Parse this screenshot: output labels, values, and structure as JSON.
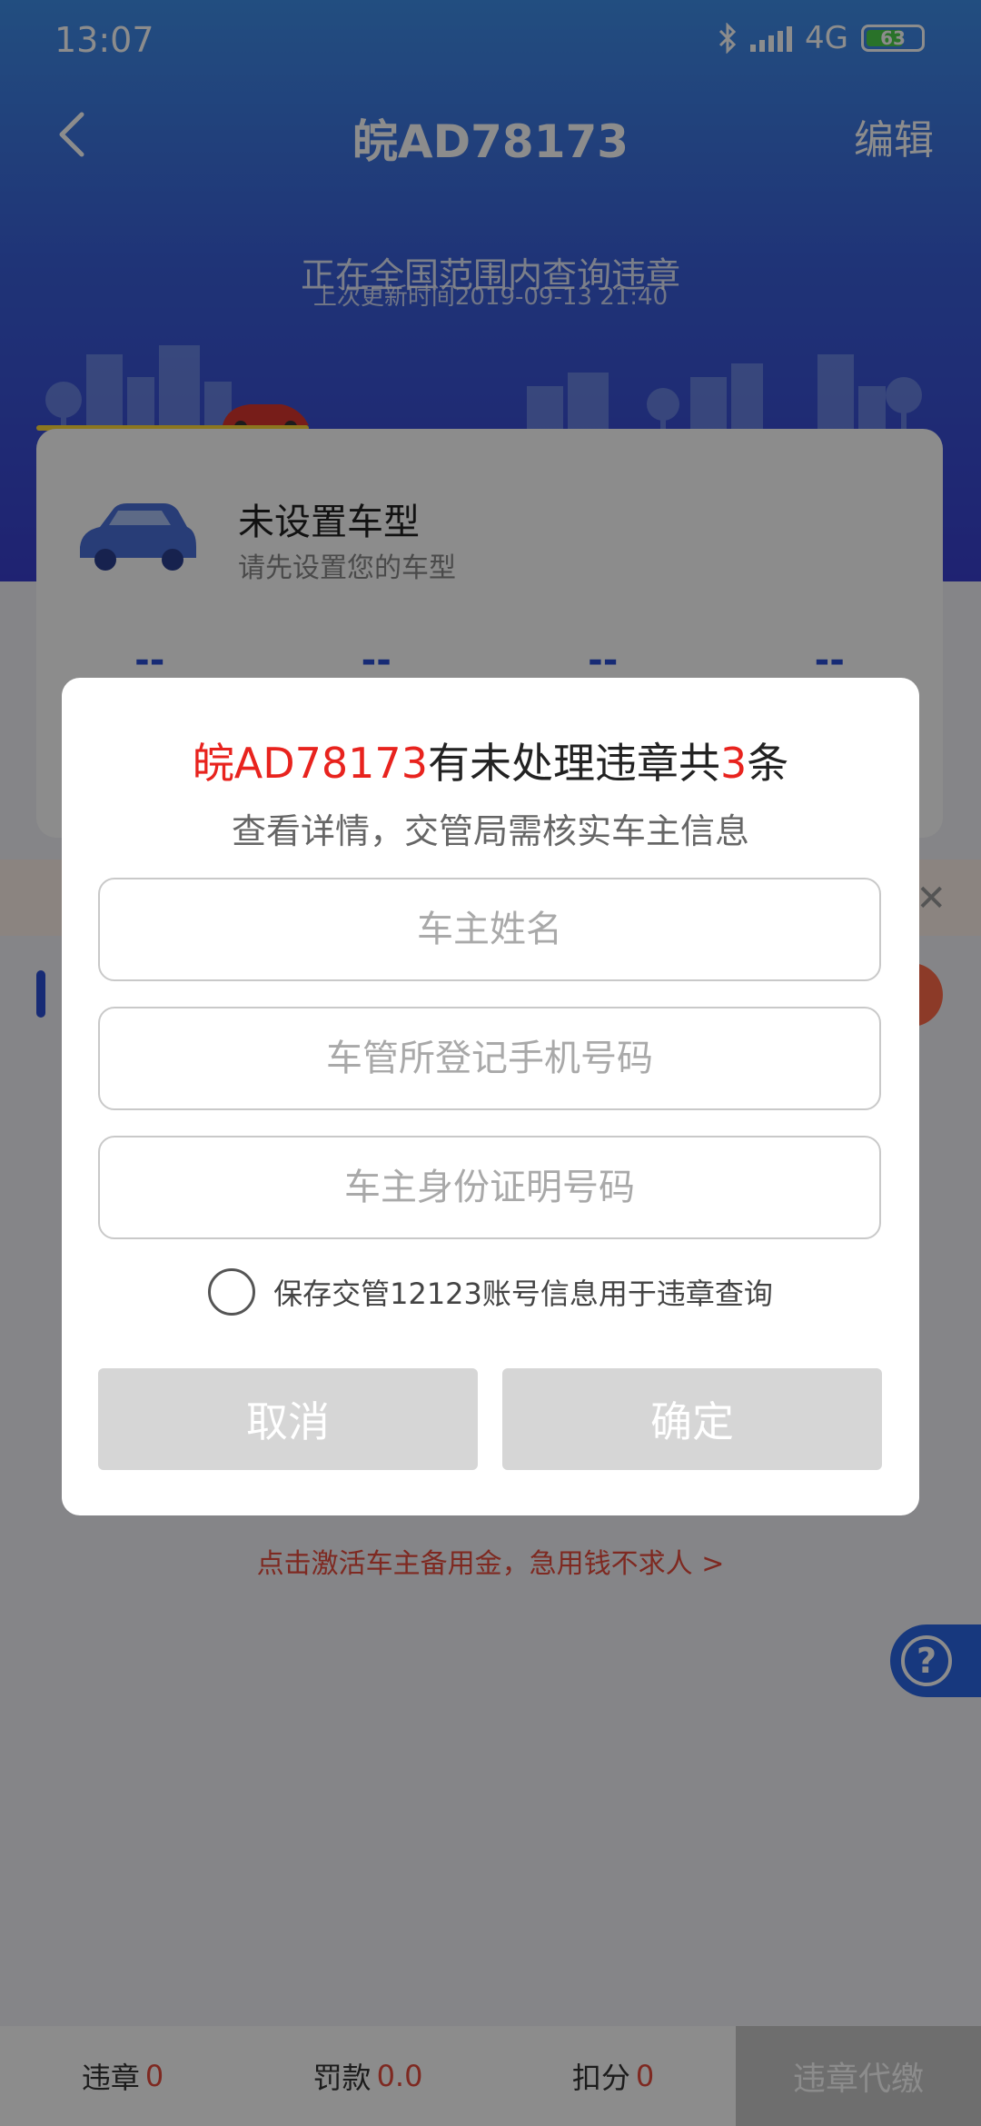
{
  "status_bar": {
    "time": "13:07",
    "network": "4G",
    "battery": "63"
  },
  "nav": {
    "title": "皖AD78173",
    "edit_label": "编辑"
  },
  "hero": {
    "message": "正在全国范围内查询违章",
    "last_update": "上次更新时间2019-09-13 21:40"
  },
  "card": {
    "title": "未设置车型",
    "subtitle": "请先设置您的车型",
    "stats": [
      "--",
      "--",
      "--",
      "--"
    ]
  },
  "promo": {
    "link": "点击激活车主备用金，急用钱不求人 >"
  },
  "bottom": {
    "violations_label": "违章",
    "violations_value": "0",
    "fines_label": "罚款",
    "fines_value": "0.0",
    "points_label": "扣分",
    "points_value": "0",
    "cta_label": "违章代缴"
  },
  "dialog": {
    "plate": "皖AD78173",
    "title_middle": "有未处理违章共",
    "count": "3",
    "title_suffix": "条",
    "subtitle": "查看详情，交管局需核实车主信息",
    "name_placeholder": "车主姓名",
    "phone_placeholder": "车管所登记手机号码",
    "id_placeholder": "车主身份证明号码",
    "save_label": "保存交管12123账号信息用于违章查询",
    "cancel_label": "取消",
    "confirm_label": "确定"
  },
  "colors": {
    "accent_blue": "#2a4fd6",
    "alert_red": "#e8231e",
    "button_disabled": "#d6d6d6"
  }
}
